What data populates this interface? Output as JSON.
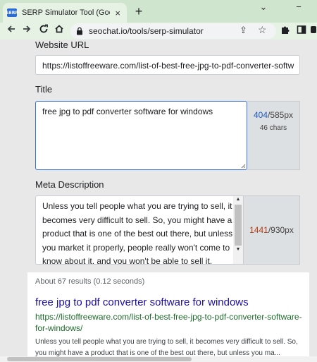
{
  "browser": {
    "tab_title": "SERP Simulator Tool (Google Snip",
    "favicon_text": "SERP",
    "tab_close": "×",
    "new_tab": "+",
    "url": "seochat.io/tools/serp-simulator",
    "window_controls": [
      "⌄",
      "−"
    ]
  },
  "form": {
    "website_url_label": "Website URL",
    "website_url_value": "https://listoffreeware.com/list-of-best-free-jpg-to-pdf-converter-softw",
    "title_label": "Title",
    "title_value": "free jpg to pdf converter software for windows",
    "title_px_used": "404",
    "title_px_max": "/585px",
    "title_chars": "46 chars",
    "meta_label": "Meta Description",
    "meta_value": "Unless you tell people what you are trying to sell, it becomes very difficult to sell. So, you might have a product that is one of the best out there, but unless you market it properly, people really won't come to know about it, and you won't be able to sell it.",
    "meta_px_used": "1441",
    "meta_px_max": "/930px"
  },
  "serp": {
    "stats": "About 67 results (0.12 seconds)",
    "title": "free jpg to pdf converter software for windows",
    "url": "https://listoffreeware.com/list-of-best-free-jpg-to-pdf-converter-software-for-windows/",
    "description": "Unless you tell people what you are trying to sell, it becomes very difficult to sell. So, you might have a product that is one of the best out there, but unless you ma..."
  },
  "colors": {
    "title_count": "#1a56c4",
    "meta_count_over": "#b33a12",
    "serp_link": "#1a0dab",
    "serp_url": "#1e6b2b"
  }
}
